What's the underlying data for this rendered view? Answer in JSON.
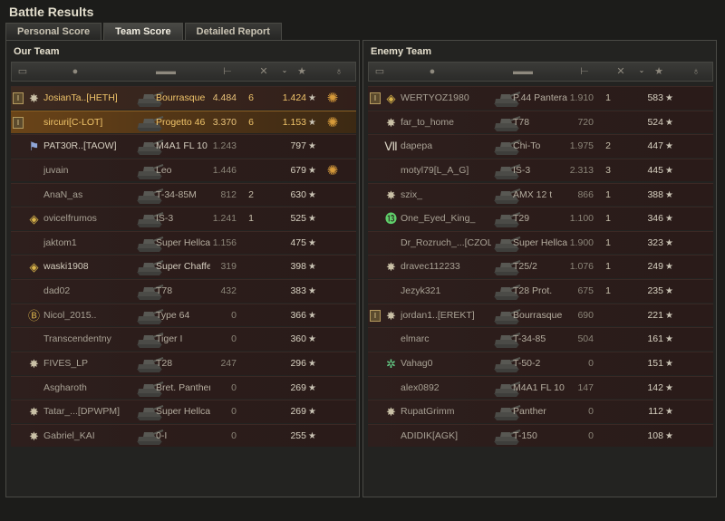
{
  "window": {
    "title": "Battle Results"
  },
  "tabs": [
    "Personal Score",
    "Team Score",
    "Detailed Report"
  ],
  "active_tab": 1,
  "our_team": {
    "label": "Our Team",
    "rows": [
      {
        "platoon": "I",
        "badge": "star",
        "name": "JosianTa..[HETH]",
        "tank": "Bourrasque",
        "damage": "4.484",
        "kills": "6",
        "score": "1.424",
        "achievement": "medal",
        "highlight": "gold"
      },
      {
        "platoon": "I",
        "badge": "",
        "name": "sircuri[C-LOT]",
        "tank": "Progetto 46",
        "damage": "3.370",
        "kills": "6",
        "score": "1.153",
        "achievement": "medal",
        "highlight": "self"
      },
      {
        "platoon": "",
        "badge": "flag",
        "name": "PAT30R..[TAOW]",
        "tank": "M4A1 FL 10",
        "damage": "1.243",
        "kills": "",
        "score": "797",
        "achievement": "",
        "highlight": "light"
      },
      {
        "platoon": "",
        "badge": "",
        "name": "juvain",
        "tank": "Leo",
        "damage": "1.446",
        "kills": "",
        "score": "679",
        "achievement": "medal",
        "highlight": ""
      },
      {
        "platoon": "",
        "badge": "",
        "name": "AnaN_as",
        "tank": "T-34-85M",
        "damage": "812",
        "kills": "2",
        "score": "630",
        "achievement": "",
        "highlight": ""
      },
      {
        "platoon": "",
        "badge": "diamond",
        "name": "ovicelfrumos",
        "tank": "IS-3",
        "damage": "1.241",
        "kills": "1",
        "score": "525",
        "achievement": "",
        "highlight": ""
      },
      {
        "platoon": "",
        "badge": "",
        "name": "jaktom1",
        "tank": "Super Hellcat",
        "damage": "1.156",
        "kills": "",
        "score": "475",
        "achievement": "",
        "highlight": ""
      },
      {
        "platoon": "",
        "badge": "diamond",
        "name": "waski1908",
        "tank": "Super Chaffee",
        "damage": "319",
        "kills": "",
        "score": "398",
        "achievement": "",
        "highlight": "light"
      },
      {
        "platoon": "",
        "badge": "",
        "name": "dad02",
        "tank": "T78",
        "damage": "432",
        "kills": "",
        "score": "383",
        "achievement": "",
        "highlight": ""
      },
      {
        "platoon": "",
        "badge": "coin",
        "name": "Nicol_2015..",
        "tank": "Type 64",
        "damage": "0",
        "kills": "",
        "score": "366",
        "achievement": "",
        "highlight": ""
      },
      {
        "platoon": "",
        "badge": "",
        "name": "Transcendentny",
        "tank": "Tiger I",
        "damage": "0",
        "kills": "",
        "score": "360",
        "achievement": "",
        "highlight": ""
      },
      {
        "platoon": "",
        "badge": "star",
        "name": "FIVES_LP",
        "tank": "T28",
        "damage": "247",
        "kills": "",
        "score": "296",
        "achievement": "",
        "highlight": ""
      },
      {
        "platoon": "",
        "badge": "",
        "name": "Asgharoth",
        "tank": "Bret. Panther",
        "damage": "0",
        "kills": "",
        "score": "269",
        "achievement": "",
        "highlight": ""
      },
      {
        "platoon": "",
        "badge": "star",
        "name": "Tatar_...[DPWPM]",
        "tank": "Super Hellcat",
        "damage": "0",
        "kills": "",
        "score": "269",
        "achievement": "",
        "highlight": ""
      },
      {
        "platoon": "",
        "badge": "star",
        "name": "Gabriel_KAI",
        "tank": "0-I",
        "damage": "0",
        "kills": "",
        "score": "255",
        "achievement": "",
        "highlight": ""
      }
    ]
  },
  "enemy_team": {
    "label": "Enemy Team",
    "rows": [
      {
        "platoon": "I",
        "badge": "diamond",
        "name": "WERTYOZ1980",
        "tank": "P.44 Pantera",
        "damage": "1.910",
        "kills": "1",
        "score": "583",
        "achievement": "",
        "highlight": ""
      },
      {
        "platoon": "",
        "badge": "star",
        "name": "far_to_home",
        "tank": "T78",
        "damage": "720",
        "kills": "",
        "score": "524",
        "achievement": "",
        "highlight": ""
      },
      {
        "platoon": "",
        "badge": "rank7",
        "name": "dapepa",
        "tank": "Chi-To",
        "damage": "1.975",
        "kills": "2",
        "score": "447",
        "achievement": "",
        "highlight": ""
      },
      {
        "platoon": "",
        "badge": "",
        "name": "motyl79[L_A_G]",
        "tank": "IS-3",
        "damage": "2.313",
        "kills": "3",
        "score": "445",
        "achievement": "",
        "highlight": ""
      },
      {
        "platoon": "",
        "badge": "star",
        "name": "szix_",
        "tank": "AMX 12 t",
        "damage": "866",
        "kills": "1",
        "score": "388",
        "achievement": "",
        "highlight": ""
      },
      {
        "platoon": "",
        "badge": "rank13",
        "name": "One_Eyed_King_",
        "tank": "T29",
        "damage": "1.100",
        "kills": "1",
        "score": "346",
        "achievement": "",
        "highlight": ""
      },
      {
        "platoon": "",
        "badge": "",
        "name": "Dr_Rozruch_...[CZOL]",
        "tank": "Super Hellcat",
        "damage": "1.900",
        "kills": "1",
        "score": "323",
        "achievement": "",
        "highlight": ""
      },
      {
        "platoon": "",
        "badge": "star",
        "name": "dravec112233",
        "tank": "T25/2",
        "damage": "1.076",
        "kills": "1",
        "score": "249",
        "achievement": "",
        "highlight": ""
      },
      {
        "platoon": "",
        "badge": "",
        "name": "Jezyk321",
        "tank": "T28 Prot.",
        "damage": "675",
        "kills": "1",
        "score": "235",
        "achievement": "",
        "highlight": ""
      },
      {
        "platoon": "I",
        "badge": "star",
        "name": "jordan1..[EREKT]",
        "tank": "Bourrasque",
        "damage": "690",
        "kills": "",
        "score": "221",
        "achievement": "",
        "highlight": ""
      },
      {
        "platoon": "",
        "badge": "",
        "name": "elmarc",
        "tank": "T-34-85",
        "damage": "504",
        "kills": "",
        "score": "161",
        "achievement": "",
        "highlight": ""
      },
      {
        "platoon": "",
        "badge": "gear",
        "name": "Vahag0",
        "tank": "T-50-2",
        "damage": "0",
        "kills": "",
        "score": "151",
        "achievement": "",
        "highlight": ""
      },
      {
        "platoon": "",
        "badge": "",
        "name": "alex0892",
        "tank": "M4A1 FL 10",
        "damage": "147",
        "kills": "",
        "score": "142",
        "achievement": "",
        "highlight": ""
      },
      {
        "platoon": "",
        "badge": "star",
        "name": "RupatGrimm",
        "tank": "Panther",
        "damage": "0",
        "kills": "",
        "score": "112",
        "achievement": "",
        "highlight": ""
      },
      {
        "platoon": "",
        "badge": "",
        "name": "ADIDIK[AGK]",
        "tank": "T-150",
        "damage": "0",
        "kills": "",
        "score": "108",
        "achievement": "",
        "highlight": ""
      }
    ]
  },
  "icons": {
    "score_icon": "star-icon",
    "medal_icon": "medal-icon",
    "platoon_icon": "platoon-icon",
    "player_icon": "player-icon",
    "tank_icon": "tank-icon",
    "damage_icon": "gun-icon",
    "kills_icon": "destroyed-tank-icon",
    "sort_icon": "chevron-down-icon"
  }
}
